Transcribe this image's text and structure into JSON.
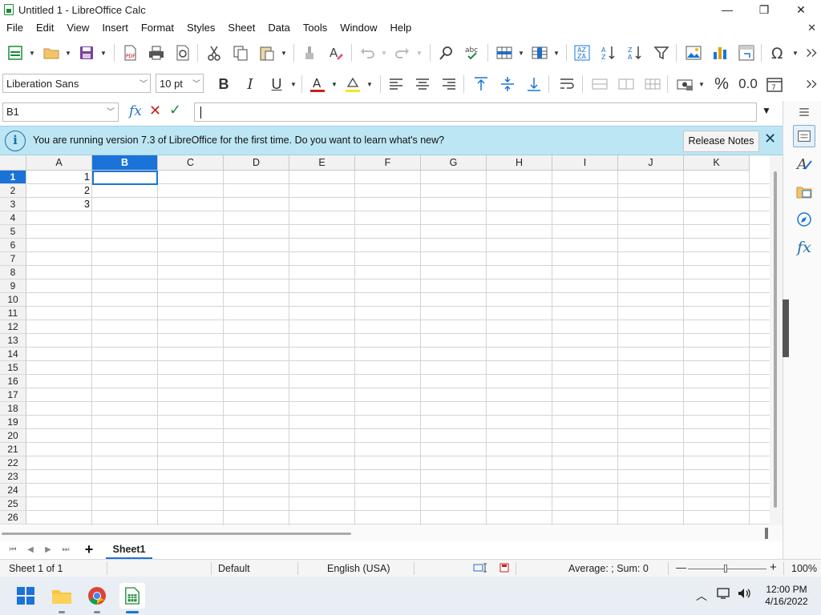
{
  "window": {
    "title": "Untitled 1 - LibreOffice Calc",
    "minimize": "—",
    "maximize": "❐",
    "close": "✕"
  },
  "menu": {
    "items": [
      "File",
      "Edit",
      "View",
      "Insert",
      "Format",
      "Styles",
      "Sheet",
      "Data",
      "Tools",
      "Window",
      "Help"
    ],
    "close": "✕"
  },
  "format_toolbar": {
    "font_name": "Liberation Sans",
    "font_size": "10 pt",
    "bold": "B",
    "italic": "I",
    "underline": "U",
    "percent": "%",
    "decimal": "0.0"
  },
  "formula_bar": {
    "cell_ref": "B1",
    "fx": "fx",
    "cancel": "✕",
    "accept": "✓",
    "content": ""
  },
  "infobar": {
    "message": "You are running version 7.3 of LibreOffice for the first time. Do you want to learn what's new?",
    "button": "Release Notes",
    "close": "✕"
  },
  "sheet": {
    "columns": [
      "A",
      "B",
      "C",
      "D",
      "E",
      "F",
      "G",
      "H",
      "I",
      "J",
      "K"
    ],
    "selected_column": "B",
    "rows": [
      "1",
      "2",
      "3",
      "4",
      "5",
      "6",
      "7",
      "8",
      "9",
      "10",
      "11",
      "12",
      "13",
      "14",
      "15",
      "16",
      "17",
      "18",
      "19",
      "20",
      "21",
      "22",
      "23",
      "24",
      "25",
      "26"
    ],
    "selected_row": "1",
    "cells": [
      {
        "ref": "A1",
        "value": "1"
      },
      {
        "ref": "A2",
        "value": "2"
      },
      {
        "ref": "A3",
        "value": "3"
      }
    ],
    "active_cell": "B1"
  },
  "tabs": {
    "sheets": [
      "Sheet1"
    ],
    "active": "Sheet1",
    "add": "+"
  },
  "status": {
    "sheet_info": "Sheet 1 of 1",
    "page_style": "Default",
    "language": "English (USA)",
    "summary": "Average: ; Sum: 0",
    "zoom": "100%",
    "zoom_out": "—",
    "zoom_in": "+"
  },
  "taskbar": {
    "time": "12:00 PM",
    "date": "4/16/2022"
  },
  "colors": {
    "accent": "#1a73d8",
    "infobar_bg": "#bde6f4",
    "calc_green": "#1e8a3a"
  }
}
